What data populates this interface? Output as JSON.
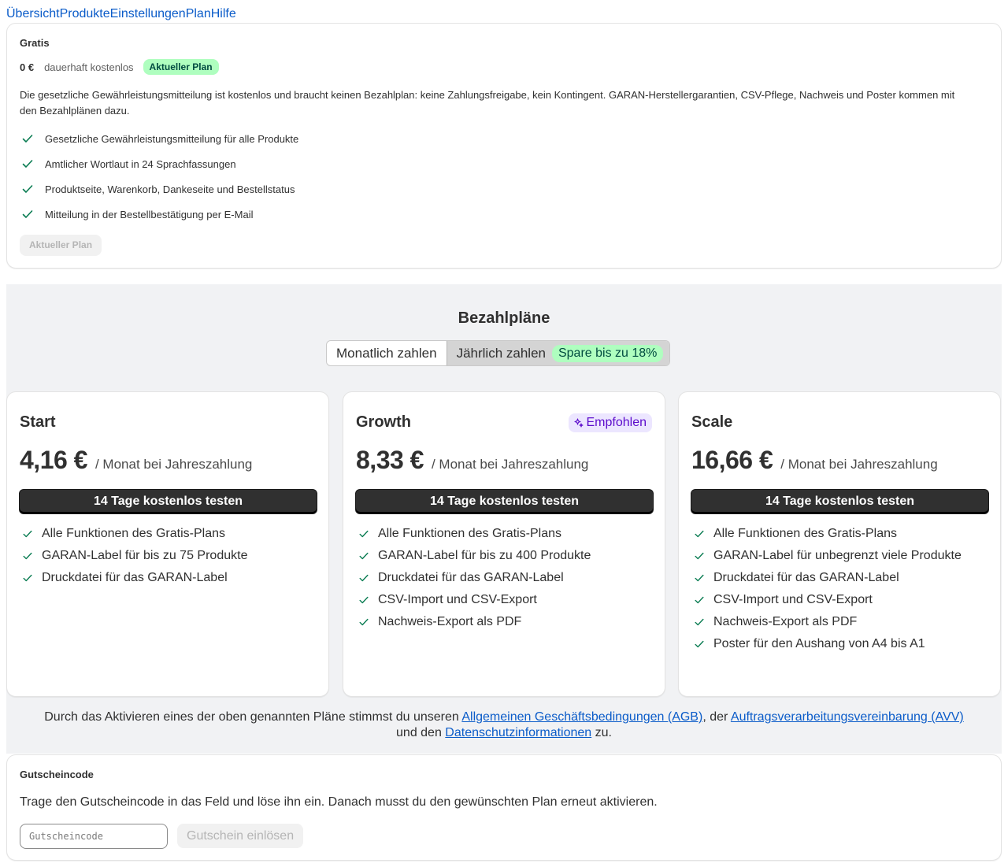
{
  "nav": [
    "Übersicht",
    "Produkte",
    "Einstellungen",
    "Plan",
    "Hilfe"
  ],
  "free_plan": {
    "title": "Gratis",
    "price": "0 €",
    "price_note": "dauerhaft kostenlos",
    "badge": "Aktueller Plan",
    "description": "Die gesetzliche Gewährleistungsmitteilung ist kostenlos und braucht keinen Bezahlplan: keine Zahlungsfreigabe, kein Kontingent. GARAN-Herstellergarantien, CSV-Pflege, Nachweis und Poster kommen mit den Bezahlplänen dazu.",
    "features": [
      "Gesetzliche Gewährleistungsmitteilung für alle Produkte",
      "Amtlicher Wortlaut in 24 Sprachfassungen",
      "Produktseite, Warenkorb, Dankeseite und Bestellstatus",
      "Mitteilung in der Bestellbestätigung per E-Mail"
    ],
    "button": "Aktueller Plan"
  },
  "paid": {
    "title": "Bezahlpläne",
    "toggle_monthly": "Monatlich zahlen",
    "toggle_yearly": "Jährlich zahlen",
    "save_badge": "Spare bis zu 18%",
    "plans": [
      {
        "name": "Start",
        "price": "4,16 €",
        "per": "/ Monat bei Jahreszahlung",
        "cta": "14 Tage kostenlos testen",
        "features": [
          "Alle Funktionen des Gratis-Plans",
          "GARAN-Label für bis zu 75 Produkte",
          "Druckdatei für das GARAN-Label"
        ]
      },
      {
        "name": "Growth",
        "badge": "Empfohlen",
        "price": "8,33 €",
        "per": "/ Monat bei Jahreszahlung",
        "cta": "14 Tage kostenlos testen",
        "features": [
          "Alle Funktionen des Gratis-Plans",
          "GARAN-Label für bis zu 400 Produkte",
          "Druckdatei für das GARAN-Label",
          "CSV-Import und CSV-Export",
          "Nachweis-Export als PDF"
        ]
      },
      {
        "name": "Scale",
        "price": "16,66 €",
        "per": "/ Monat bei Jahreszahlung",
        "cta": "14 Tage kostenlos testen",
        "features": [
          "Alle Funktionen des Gratis-Plans",
          "GARAN-Label für unbegrenzt viele Produkte",
          "Druckdatei für das GARAN-Label",
          "CSV-Import und CSV-Export",
          "Nachweis-Export als PDF",
          "Poster für den Aushang von A4 bis A1"
        ]
      }
    ],
    "terms": {
      "t1": "Durch das Aktivieren eines der oben genannten Pläne stimmst du unseren ",
      "l1": "Allgemeinen Geschäftsbedingungen (AGB)",
      "t2": ", der ",
      "l2": "Auftragsverarbeitungsvereinbarung (AVV)",
      "t3": " und den ",
      "l3": "Datenschutzinformationen",
      "t4": " zu."
    }
  },
  "coupon": {
    "title": "Gutscheincode",
    "description": "Trage den Gutscheincode in das Feld und löse ihn ein. Danach musst du den gewünschten Plan erneut aktivieren.",
    "placeholder": "Gutscheincode",
    "button": "Gutschein einlösen"
  },
  "colors": {
    "link": "#0b5cc9",
    "check": "#0a7c52",
    "badge_green_bg": "#affebf",
    "recommended_bg": "#ece6ff",
    "recommended_fg": "#5c0ccc",
    "primary_button": "#303030"
  }
}
